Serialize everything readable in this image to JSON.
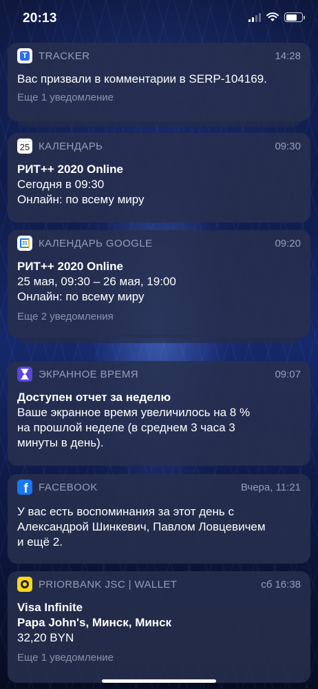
{
  "status_bar": {
    "time": "20:13"
  },
  "notifications": [
    {
      "app": "TRACKER",
      "icon": "tracker-icon",
      "time": "14:28",
      "lines": [
        "Вас призвали в комментарии в SERP-104169."
      ],
      "more": "Еще 1 уведомление"
    },
    {
      "app": "КАЛЕНДАРЬ",
      "icon": "calendar-icon",
      "icon_text": "25",
      "time": "09:30",
      "title": "РИТ++ 2020 Online",
      "lines": [
        "Сегодня в 09:30",
        "Онлайн: по всему миру"
      ]
    },
    {
      "app": "КАЛЕНДАРЬ GOOGLE",
      "icon": "google-calendar-icon",
      "icon_text": "31",
      "time": "09:20",
      "title": "РИТ++ 2020 Online",
      "lines": [
        "25 мая, 09:30 – 26 мая, 19:00",
        "Онлайн: по всему миру"
      ],
      "more": "Еще 2 уведомления"
    },
    {
      "app": "ЭКРАННОЕ ВРЕМЯ",
      "icon": "hourglass-icon",
      "time": "09:07",
      "title": "Доступен отчет за неделю",
      "lines": [
        "Ваше экранное время увеличилось на 8 %",
        "на прошлой неделе (в среднем 3 часа 3",
        "минуты в день)."
      ]
    },
    {
      "app": "FACEBOOK",
      "icon": "facebook-icon",
      "icon_text": "f",
      "time": "Вчера, 11:21",
      "lines": [
        "У вас есть воспоминания за этот день с",
        "Александрой Шинкевич, Павлом Ловцевичем",
        "и ещё 2."
      ]
    },
    {
      "app": "PRIORBANK JSC | WALLET",
      "icon": "priorbank-icon",
      "time": "сб 16:38",
      "title": "Visa Infinite",
      "title2": "Papa John's, Минск, Минск",
      "lines": [
        "32,20 BYN"
      ],
      "more": "Еще 1 уведомление"
    }
  ]
}
